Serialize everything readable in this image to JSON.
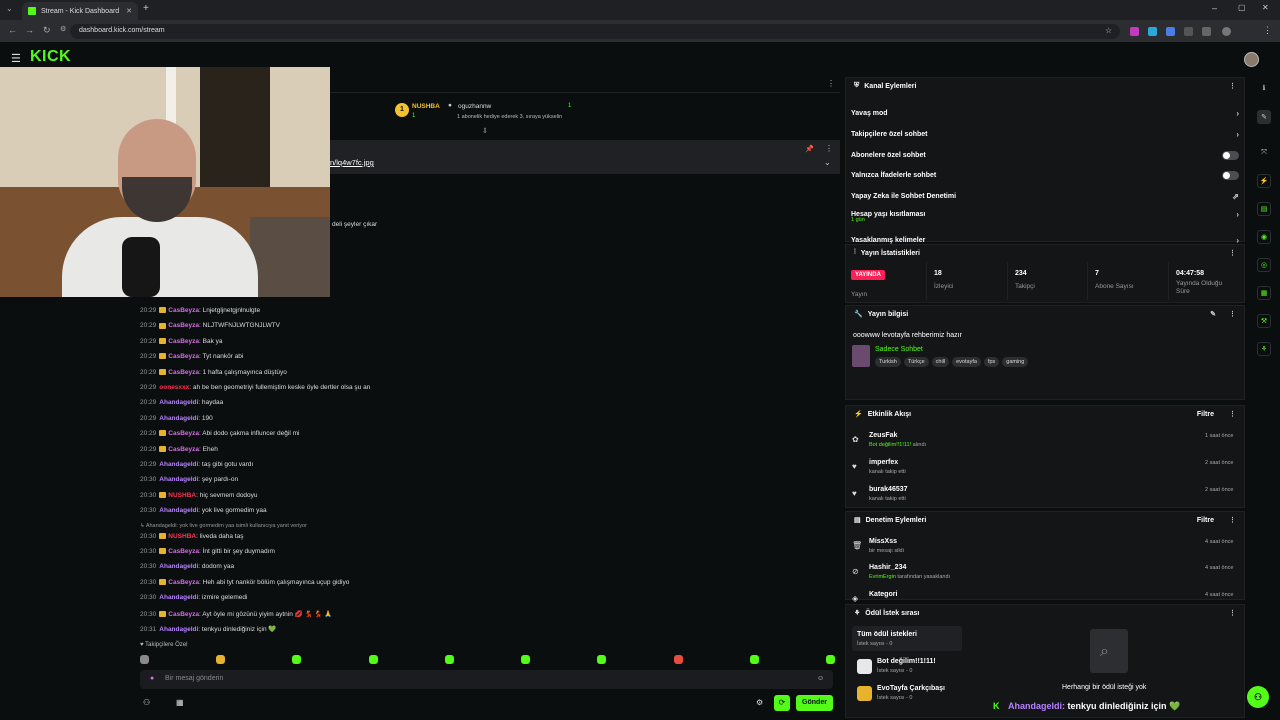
{
  "browser": {
    "tab_title": "Stream - Kick Dashboard",
    "tab_close": "✕",
    "new_tab": "+",
    "url": "dashboard.kick.com/stream"
  },
  "brand": {
    "logo": "KICK",
    "accent": "#53fc18"
  },
  "chat": {
    "top_gift": {
      "user": "NUSHBA",
      "count": "1",
      "gifter": "oguzhannw",
      "gifter_count": "1",
      "note": "1 abonelik hediye ederek 3. sıraya yükselin"
    },
    "pinned_link": "n/lq4w7fc.jpg",
    "partial_message": "deli şeyler çıkar",
    "messages": [
      {
        "time": "20:29",
        "user": "CasBeyza",
        "style": "pink",
        "badge": true,
        "text": "Lnjetgljnetgjnlnulgte"
      },
      {
        "time": "20:29",
        "user": "CasBeyza",
        "style": "pink",
        "badge": true,
        "text": "NLJTWFNJLWTGNJLWTV"
      },
      {
        "time": "20:29",
        "user": "CasBeyza",
        "style": "pink",
        "badge": true,
        "text": "Bak ya"
      },
      {
        "time": "20:29",
        "user": "CasBeyza",
        "style": "pink",
        "badge": true,
        "text": "Tyt nankör abi"
      },
      {
        "time": "20:29",
        "user": "CasBeyza",
        "style": "pink",
        "badge": true,
        "text": "1 hafta çalışmayınca düştüyo"
      },
      {
        "time": "20:29",
        "user": "oonesxxx",
        "style": "red",
        "badge": false,
        "text": "ah be ben geometriyi fullemiştim keske öyle dertler olsa şu an"
      },
      {
        "time": "20:29",
        "user": "Ahandageldi",
        "style": "purple",
        "badge": false,
        "text": "haydaa"
      },
      {
        "time": "20:29",
        "user": "Ahandageldi",
        "style": "purple",
        "badge": false,
        "text": "190"
      },
      {
        "time": "20:29",
        "user": "CasBeyza",
        "style": "pink",
        "badge": true,
        "text": "Abi dodo çakma influncer değil mi"
      },
      {
        "time": "20:29",
        "user": "CasBeyza",
        "style": "pink",
        "badge": true,
        "text": "Eheh"
      },
      {
        "time": "20:29",
        "user": "Ahandageldi",
        "style": "purple",
        "badge": false,
        "text": "taş gibi gotu vardı"
      },
      {
        "time": "20:30",
        "user": "Ahandageldi",
        "style": "purple",
        "badge": false,
        "text": "şey pardı-on"
      },
      {
        "time": "20:30",
        "user": "NUSHBA",
        "style": "red",
        "badge": true,
        "text": "hiç sevmem dodoyu"
      },
      {
        "time": "20:30",
        "user": "Ahandageldi",
        "style": "purple",
        "badge": false,
        "text": "yok live gormedim yaa"
      },
      {
        "time": "",
        "user": "",
        "style": "reply",
        "badge": false,
        "text": "↳ Ahandageldi: yok live gormedim yaa isimli kullanıcıya yanıt veriyor"
      },
      {
        "time": "20:30",
        "user": "NUSHBA",
        "style": "red",
        "badge": true,
        "text": "liveda daha taş"
      },
      {
        "time": "20:30",
        "user": "CasBeyza",
        "style": "pink",
        "badge": true,
        "text": "İnt gitti bir şey duymadım"
      },
      {
        "time": "20:30",
        "user": "Ahandageldi",
        "style": "purple",
        "badge": false,
        "text": "dodom yaa"
      },
      {
        "time": "20:30",
        "user": "CasBeyza",
        "style": "pink",
        "badge": true,
        "text": "Heh abi tyt nankör bölüm çalışmayınca uçup gidiyo"
      },
      {
        "time": "20:30",
        "user": "Ahandageldi",
        "style": "purple",
        "badge": false,
        "text": "izmire gelemedi"
      },
      {
        "time": "20:30",
        "user": "CasBeyza",
        "style": "pink",
        "badge": true,
        "text": "Ayt öyle mi gözünü yiyim aytnin 💋 💃 💃 🙏"
      },
      {
        "time": "20:31",
        "user": "Ahandageldi",
        "style": "purple",
        "badge": false,
        "text": "tenkyu dinlediğiniz için 💚"
      }
    ],
    "followers_only": "♥ Takipçilere Özel",
    "input_placeholder": "Bir mesaj gönderin",
    "send_label": "Gönder"
  },
  "channel_actions": {
    "title": "Kanal Eylemleri",
    "rows": [
      {
        "label": "Yavaş mod",
        "control": "chevron"
      },
      {
        "label": "Takipçilere özel sohbet",
        "control": "chevron"
      },
      {
        "label": "Abonelere özel sohbet",
        "control": "toggle"
      },
      {
        "label": "Yalnızca İfadelerle sohbet",
        "control": "toggle"
      },
      {
        "label": "Yapay Zeka ile Sohbet Denetimi",
        "control": "external"
      },
      {
        "label": "Hesap yaşı kısıtlaması",
        "sub": "1 gün",
        "control": "chevron"
      },
      {
        "label": "Yasaklanmış kelimeler",
        "control": "chevron"
      }
    ]
  },
  "stream_stats": {
    "title": "Yayın İstatistikleri",
    "live_badge": "YAYINDA",
    "live_label": "Yayın",
    "stats": [
      {
        "value": "18",
        "label": "İzleyici"
      },
      {
        "value": "234",
        "label": "Takipçi"
      },
      {
        "value": "7",
        "label": "Abone Sayısı"
      },
      {
        "value": "04:47:58",
        "label": "Yayında Olduğu Süre"
      }
    ]
  },
  "stream_info": {
    "title": "Yayın bilgisi",
    "stream_title": "ooowww levotayfa rehberimiz hazır",
    "category": "Sadece Sohbet",
    "tags": [
      "Turkish",
      "Türkçe",
      "chill",
      "evotayfa",
      "fps",
      "gaming"
    ]
  },
  "activity": {
    "title": "Etkinlik Akışı",
    "filter": "Filtre",
    "items": [
      {
        "name": "ZeusFak",
        "desc_highlight": "Bot değilim!!1!11!",
        "desc": " alındı",
        "time": "1 saat önce",
        "icon": "gift-icon"
      },
      {
        "name": "imperfex",
        "desc": "kanalı takip etti",
        "time": "2 saat önce",
        "icon": "heart-icon"
      },
      {
        "name": "burak46537",
        "desc": "kanalı takip etti",
        "time": "2 saat önce",
        "icon": "heart-icon"
      }
    ]
  },
  "moderation": {
    "title": "Denetim Eylemleri",
    "filter": "Filtre",
    "items": [
      {
        "name": "MissXss",
        "desc": "bir mesajı sildi",
        "time": "4 saat önce",
        "icon": "trash-icon"
      },
      {
        "name": "Hashir_234",
        "desc_highlight": "EvrimErgin",
        "desc": " tarafından yasaklandı",
        "time": "4 saat önce",
        "icon": "ban-icon"
      },
      {
        "name": "Kategori",
        "desc": "",
        "time": "4 saat önce",
        "icon": "category-icon"
      }
    ]
  },
  "rewards": {
    "title": "Ödül İstek sırası",
    "items": [
      {
        "name": "Tüm ödül istekleri",
        "count": "İstek sayısı - 0"
      },
      {
        "name": "Bot değilim!!1!11!",
        "count": "İstek sayısı - 0"
      },
      {
        "name": "EvoTayfa Çarkçıbaşı",
        "count": "İstek sayısı - 0"
      }
    ],
    "empty": "Herhangi bir ödül isteği yok"
  },
  "overlay": {
    "user": "Ahandageldi",
    "text": "tenkyu dinlediğiniz için 💚"
  }
}
